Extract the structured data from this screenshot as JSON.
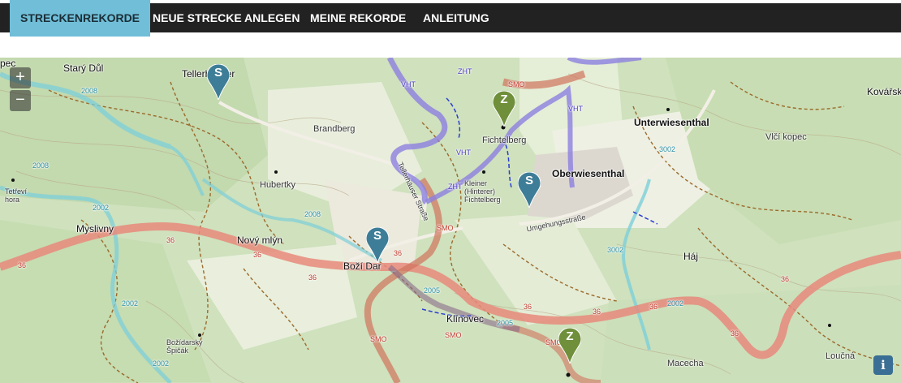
{
  "nav": {
    "tabs": [
      {
        "label": "STRECKENREKORDE",
        "active": true
      },
      {
        "label": "NEUE STRECKE ANLEGEN",
        "active": false
      },
      {
        "label": "MEINE REKORDE",
        "active": false
      },
      {
        "label": "ANLEITUNG",
        "active": false
      }
    ],
    "active_color": "#70bed8",
    "bar_color": "#222222"
  },
  "map": {
    "zoom_in": "+",
    "zoom_out": "−",
    "info": "i",
    "places": {
      "pec": "pec",
      "stary_dul": "Starý Důl",
      "tellerhaeuser": "Tellerhäuser",
      "brandberg": "Brandberg",
      "hubertky": "Hubertky",
      "tetrevi_hora": "Tetřeví\nhora",
      "myslivny": "Myslivny",
      "novy_mlyn": "Nový mlýn",
      "bozi_dar": "Boží Dar",
      "klinovec": "Klínovec",
      "bozidarsky_spicak": "Božídarský\nŠpičák",
      "fichtelberg": "Fichtelberg",
      "kleiner_fichtelberg": "Kleiner\n(Hinterer)\nFichtelberg",
      "unterwiesenthal": "Unterwiesenthal",
      "oberwiesenthal": "Oberwiesenthal",
      "kovarska": "Kovářsk",
      "vlci_kopec": "Vlčí kopec",
      "haj": "Háj",
      "macecha": "Macecha",
      "loucna": "Loučná",
      "umgehungsstrasse": "Umgehungsstraße",
      "tellerhaeuser_strasse": "Tellerhäuser Straße"
    },
    "route_labels": {
      "r36": "36",
      "r2008": "2008",
      "r2002": "2002",
      "r2005": "2005",
      "r3002": "3002",
      "smo": "SMO",
      "vht": "VHT",
      "zht": "ZHT"
    },
    "markers": [
      {
        "letter": "S",
        "type": "start",
        "color": "#3e7d97"
      },
      {
        "letter": "S",
        "type": "start",
        "color": "#3e7d97"
      },
      {
        "letter": "S",
        "type": "start",
        "color": "#3e7d97"
      },
      {
        "letter": "Z",
        "type": "finish",
        "color": "#6f8f3a"
      },
      {
        "letter": "Z",
        "type": "finish",
        "color": "#6f8f3a"
      }
    ],
    "colors": {
      "road_36": "#e8897b",
      "trail_2008": "#7ccfd9",
      "smo": "#d0735d",
      "vht": "#8c7fe0",
      "forest": "#c5dbb3",
      "meadow": "#e6eed6"
    }
  }
}
